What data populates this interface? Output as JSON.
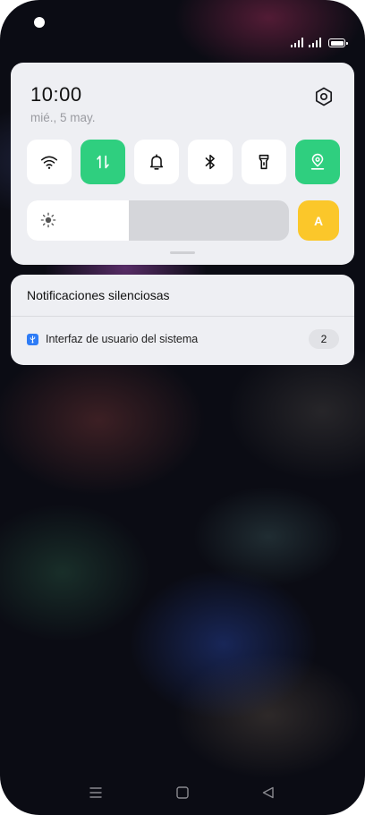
{
  "status_bar": {
    "icons": [
      "camera-icon",
      "signal-icon",
      "signal-icon",
      "battery-icon"
    ],
    "battery_level": 1.0
  },
  "quick_settings": {
    "time": "10:00",
    "date": "mié., 5 may.",
    "settings_icon": "gear-icon",
    "tiles": [
      {
        "icon": "wifi-icon",
        "active": false
      },
      {
        "icon": "mobile-data-icon",
        "active": true
      },
      {
        "icon": "bell-icon",
        "active": false
      },
      {
        "icon": "bluetooth-icon",
        "active": false
      },
      {
        "icon": "flashlight-icon",
        "active": false
      },
      {
        "icon": "location-icon",
        "active": true
      }
    ],
    "brightness_level": 0.39,
    "auto_brightness_label": "A",
    "colors": {
      "panel": "#eeeff3",
      "active_tile": "#2fcf7f",
      "auto_button": "#fbc72a"
    }
  },
  "notifications": {
    "header": "Notificaciones silenciosas",
    "items": [
      {
        "app_icon": "usb-icon",
        "app_name": "Interfaz de usuario del sistema",
        "count": "2"
      }
    ]
  },
  "nav_bar": {
    "buttons": [
      "menu-icon",
      "home-icon",
      "back-icon"
    ]
  }
}
